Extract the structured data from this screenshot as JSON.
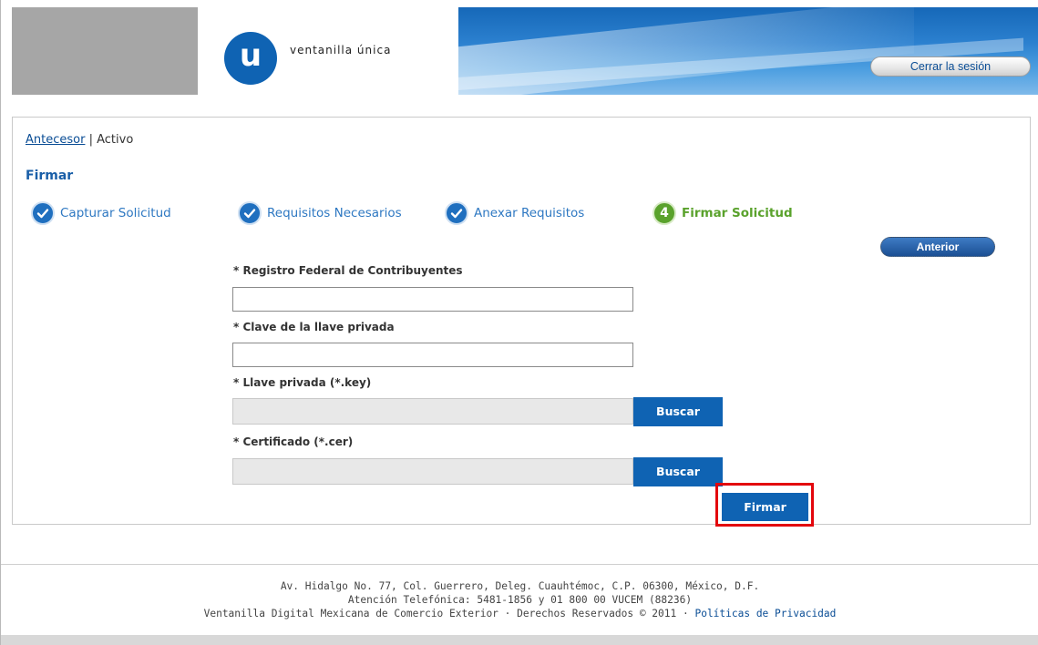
{
  "header": {
    "logo_letter": "u",
    "logo_text": "ventanilla única",
    "logout_label": "Cerrar la sesión"
  },
  "breadcrumb": {
    "link": "Antecesor",
    "separator": "|",
    "current": "Activo"
  },
  "page_title": "Firmar",
  "steps": [
    {
      "label": "Capturar Solicitud",
      "state": "done"
    },
    {
      "label": "Requisitos Necesarios",
      "state": "done"
    },
    {
      "label": "Anexar Requisitos",
      "state": "done"
    },
    {
      "label": "Firmar Solicitud",
      "state": "active",
      "number": "4"
    }
  ],
  "buttons": {
    "previous": "Anterior",
    "browse": "Buscar",
    "sign": "Firmar"
  },
  "form": {
    "rfc_label": "* Registro Federal de Contribuyentes",
    "rfc_value": "",
    "key_password_label": "* Clave de la llave privada",
    "key_password_value": "",
    "private_key_label": "* Llave privada (*.key)",
    "private_key_value": "",
    "certificate_label": "* Certificado (*.cer)",
    "certificate_value": ""
  },
  "footer": {
    "line1": "Av. Hidalgo No. 77, Col. Guerrero, Deleg. Cuauhtémoc, C.P. 06300, México, D.F.",
    "line2": "Atención Telefónica: 5481-1856 y 01 800 00 VUCEM (88236)",
    "line3": "Ventanilla Digital Mexicana de Comercio Exterior · Derechos Reservados © 2011 ·",
    "privacy_link": "Políticas de Privacidad"
  },
  "colors": {
    "brand_blue": "#0f63b3",
    "active_green": "#5aa22c",
    "highlight_red": "#e3060c"
  }
}
